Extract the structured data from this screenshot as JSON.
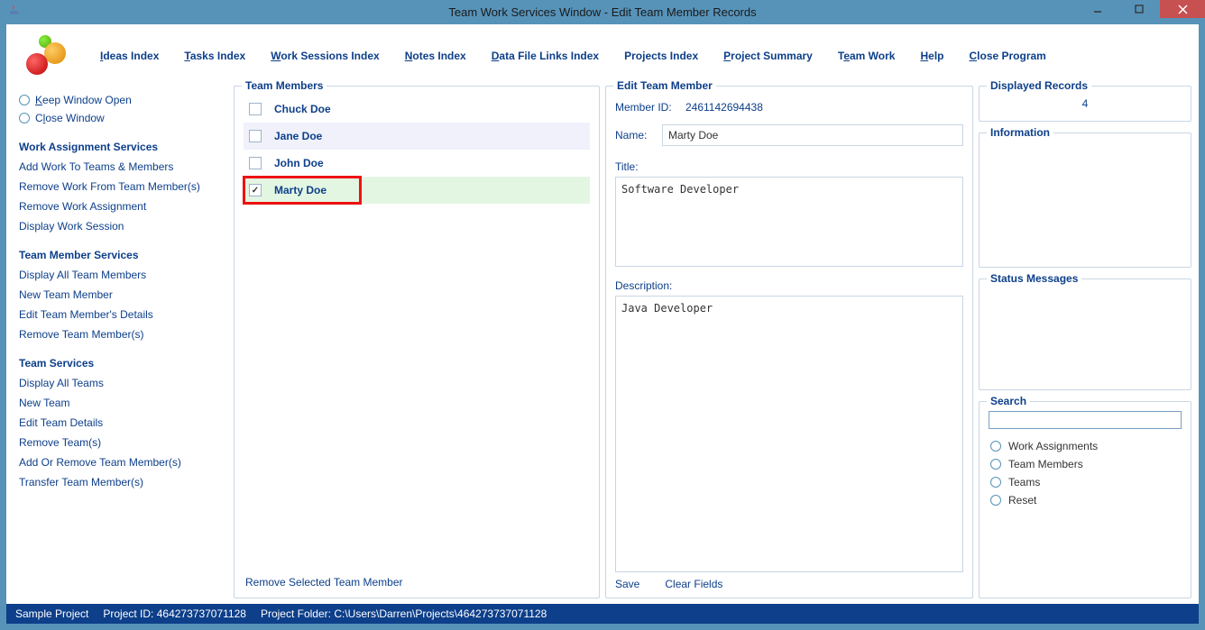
{
  "window": {
    "title": "Team Work Services Window - Edit Team Member Records"
  },
  "menu": {
    "ideas": "Ideas Index",
    "tasks": "Tasks Index",
    "work_sessions": "Work Sessions Index",
    "notes": "Notes Index",
    "data_file": "Data File Links Index",
    "projects": "Projects Index",
    "project_summary": "Project Summary",
    "team_work": "Team Work",
    "help": "Help",
    "close_program": "Close Program"
  },
  "sidebar": {
    "keep_open": "Keep Window Open",
    "close_window": "Close Window",
    "headings": {
      "work_assignment": "Work Assignment Services",
      "team_member": "Team Member Services",
      "team": "Team Services"
    },
    "links": {
      "add_work": "Add Work To Teams & Members",
      "remove_work_member": "Remove Work From Team Member(s)",
      "remove_work_assignment": "Remove Work Assignment",
      "display_work_session": "Display Work Session",
      "display_all_members": "Display All Team Members",
      "new_team_member": "New Team Member",
      "edit_member_details": "Edit Team Member's Details",
      "remove_members": "Remove Team Member(s)",
      "display_all_teams": "Display All Teams",
      "new_team": "New Team",
      "edit_team_details": "Edit Team Details",
      "remove_teams": "Remove Team(s)",
      "add_remove_members": "Add Or Remove Team Member(s)",
      "transfer_members": "Transfer Team Member(s)"
    }
  },
  "team_members": {
    "legend": "Team Members",
    "items": [
      {
        "name": "Chuck Doe",
        "checked": false
      },
      {
        "name": "Jane Doe",
        "checked": false
      },
      {
        "name": "John Doe",
        "checked": false
      },
      {
        "name": "Marty Doe",
        "checked": true
      }
    ],
    "remove_label": "Remove Selected Team Member"
  },
  "edit": {
    "legend": "Edit Team Member",
    "member_id_label": "Member ID:",
    "member_id": "2461142694438",
    "name_label": "Name:",
    "name": "Marty Doe",
    "title_label": "Title:",
    "title": "Software Developer",
    "description_label": "Description:",
    "description": "Java Developer",
    "save_label": "Save",
    "clear_label": "Clear Fields"
  },
  "right": {
    "displayed_legend": "Displayed Records",
    "displayed_value": "4",
    "information_legend": "Information",
    "status_legend": "Status Messages",
    "search_legend": "Search",
    "search_options": {
      "work_assignments": "Work Assignments",
      "team_members": "Team Members",
      "teams": "Teams",
      "reset": "Reset"
    }
  },
  "statusbar": {
    "project": "Sample Project",
    "project_id_label": "Project ID:",
    "project_id": "464273737071128",
    "folder_label": "Project Folder:",
    "folder": "C:\\Users\\Darren\\Projects\\464273737071128"
  }
}
